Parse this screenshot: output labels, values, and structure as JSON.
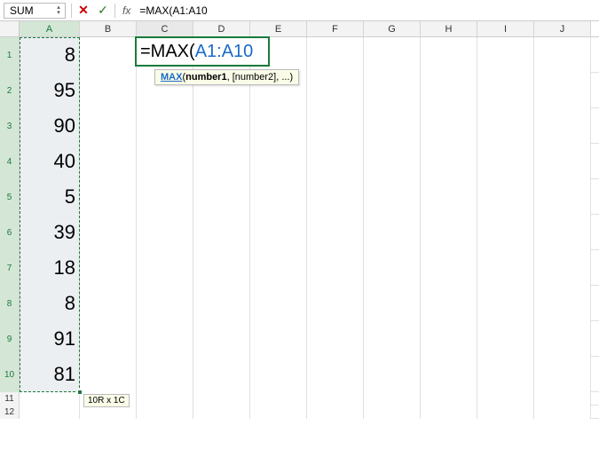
{
  "nameBox": "SUM",
  "formula": "=MAX(A1:A10",
  "columns": [
    "A",
    "B",
    "C",
    "D",
    "E",
    "F",
    "G",
    "H",
    "I",
    "J"
  ],
  "rows": [
    "1",
    "2",
    "3",
    "4",
    "5",
    "6",
    "7",
    "8",
    "9",
    "10",
    "11",
    "12"
  ],
  "colA": [
    "8",
    "95",
    "90",
    "40",
    "5",
    "39",
    "18",
    "8",
    "91",
    "81"
  ],
  "editing": {
    "prefix": "=MAX(",
    "argument": "A1:A10"
  },
  "tooltip": {
    "fn": "MAX",
    "open": "(",
    "arg1": "number1",
    "rest": ", [number2], ...)"
  },
  "sizeHint": "10R x 1C",
  "layout": {
    "rowHeaderW": 22,
    "colAWidth": 68,
    "colDefault": 64,
    "rowBig": 40,
    "rowSmall": 15
  }
}
